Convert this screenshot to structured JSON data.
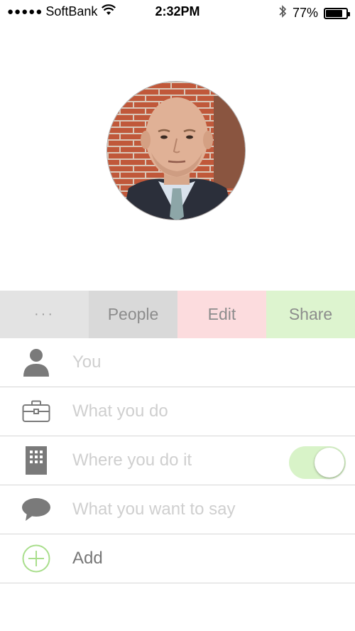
{
  "status_bar": {
    "signal_dots": "●●●●●",
    "carrier": "SoftBank",
    "time": "2:32PM",
    "battery_percent": "77%",
    "battery_level": 0.77
  },
  "profile": {
    "avatar_icon": "profile-photo"
  },
  "tabs": [
    {
      "label": "···",
      "color": "#e3e3e3"
    },
    {
      "label": "People",
      "color": "#d9d9d9"
    },
    {
      "label": "Edit",
      "color": "#fcdcde"
    },
    {
      "label": "Share",
      "color": "#ddf4cf"
    }
  ],
  "fields": [
    {
      "icon": "person-icon",
      "placeholder": "You"
    },
    {
      "icon": "briefcase-icon",
      "placeholder": "What you do"
    },
    {
      "icon": "building-icon",
      "placeholder": "Where you do it",
      "toggle_on": true
    },
    {
      "icon": "speech-bubble-icon",
      "placeholder": "What you want to say"
    },
    {
      "icon": "plus-circle-icon",
      "label": "Add"
    }
  ],
  "colors": {
    "accent_green": "#c7eab0",
    "placeholder": "#cfcfcf"
  }
}
